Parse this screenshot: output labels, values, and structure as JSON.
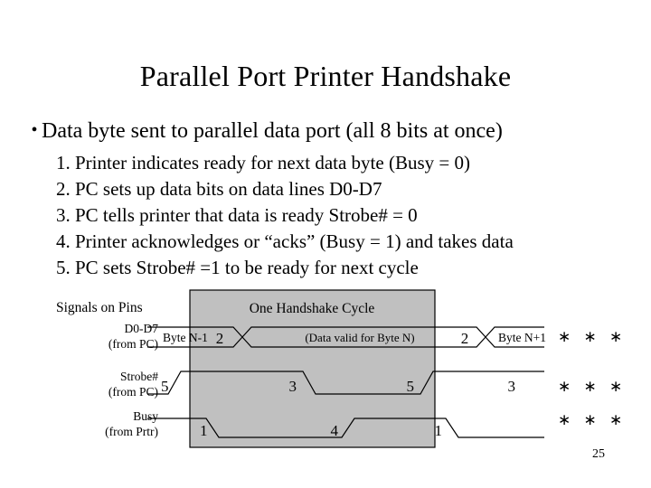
{
  "slide": {
    "title": "Parallel Port Printer Handshake",
    "page_number": "25",
    "bullet_marker": "•",
    "bullet": "Data byte sent to parallel data port (all 8 bits at once)",
    "steps": [
      "1. Printer indicates ready for next data byte (Busy = 0)",
      "2. PC sets up data bits on data lines D0-D7",
      "3. PC tells printer that data is ready Strobe# = 0",
      "4. Printer acknowledges or “acks” (Busy = 1) and takes data",
      "5. PC sets Strobe# =1 to be ready for next cycle"
    ]
  },
  "diagram": {
    "caption_left": "Signals on Pins",
    "cycle_label": "One Handshake Cycle",
    "highlight_color": "#c0c0c0",
    "line_color": "#000000",
    "signals": [
      {
        "name": "D0-D7",
        "source": "(from PC)",
        "label_line1": "D0-D7",
        "label_line2": "(from PC)",
        "annotations": [
          "Byte N-1",
          "2",
          "(Data valid for Byte N)",
          "2",
          "Byte N+1"
        ],
        "continuation": "∗ ∗ ∗"
      },
      {
        "name": "Strobe#",
        "source": "(from PC)",
        "label_line1": "Strobe#",
        "label_line2": "(from PC)",
        "annotations": [
          "5",
          "3",
          "5",
          "3"
        ],
        "continuation": "∗ ∗ ∗"
      },
      {
        "name": "Busy",
        "source": "(from Prtr)",
        "label_line1": "Busy",
        "label_line2": "(from Prtr)",
        "annotations": [
          "1",
          "4",
          "1"
        ],
        "continuation": "∗ ∗ ∗"
      }
    ]
  }
}
